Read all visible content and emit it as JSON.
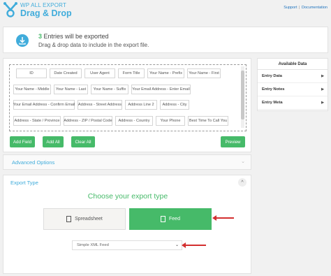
{
  "header": {
    "brand_small": "WP ALL EXPORT",
    "brand_big": "Drag & Drop",
    "support_link": "Support",
    "separator": "|",
    "docs_link": "Documentation"
  },
  "notice": {
    "count": "3",
    "line1_rest": " Entries will be exported",
    "line2": "Drag & drop data to include in the export file."
  },
  "fields": [
    "ID",
    "Date Created",
    "User Agent",
    "Form Title",
    "Your Name - Prefix",
    "Your Name - First",
    "Your Name - Middle",
    "Your Name - Last",
    "Your Name - Suffix",
    "Your Email Address - Enter Email",
    "Your Email Address - Confirm Email",
    "Address - Street Address",
    "Address Line 2",
    "Address - City",
    "Address - State / Province",
    "Address - ZIP / Postal Code",
    "Address - Country",
    "Your Phone",
    "Best Time To Call You"
  ],
  "buttons": {
    "add_field": "Add Field",
    "add_all": "Add All",
    "clear_all": "Clear All",
    "preview": "Preview"
  },
  "advanced_options": "Advanced Options",
  "export_type": {
    "title": "Export Type",
    "choose": "Choose your export type",
    "spreadsheet": "Spreadsheet",
    "feed": "Feed",
    "toggle": "^",
    "selected_feed": "Simple XML Feed"
  },
  "sidebar": {
    "title": "Available Data",
    "items": [
      "Entry Data",
      "Entry Notes",
      "Entry Meta"
    ]
  },
  "colors": {
    "accent_blue": "#40acdb",
    "green": "#46ba69",
    "arrow_red": "#d32f2f"
  }
}
